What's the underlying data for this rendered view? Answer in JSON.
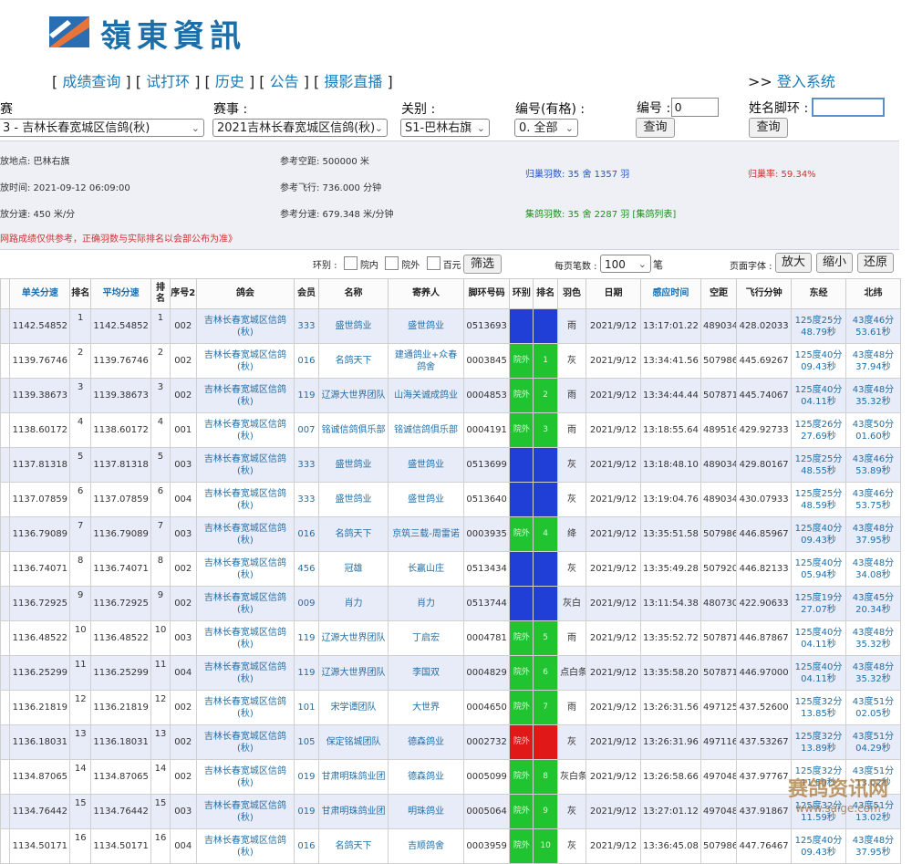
{
  "logo": {
    "text": "嶺東資訊",
    "icon": "logo-flag-icon"
  },
  "nav": {
    "items": [
      "成绩查询",
      "试打环",
      "历史",
      "公告",
      "摄影直播"
    ],
    "login_prefix": ">>",
    "login_label": "登入系统"
  },
  "filters": {
    "season_label": "赛",
    "season_value": "3 - 吉林长春宽城区信鸽(秋)",
    "race_label": "赛事 :",
    "race_value": "2021吉林长春宽城区信鸽(秋)",
    "stage_label": "关别 :",
    "stage_value": "S1-巴林右旗",
    "num_has_label": "编号(有格) :",
    "num_has_value": "0. 全部",
    "num_label": "编号 :",
    "num_value": "0",
    "query_label": "查询",
    "name_ring_label": "姓名脚环 :",
    "name_ring_value": "",
    "query2_label": "查询"
  },
  "info": {
    "release_place": "放地点:  巴林右旗",
    "release_time": "放时间:  2021-09-12 06:09:00",
    "speed": "放分速:  450 米/分",
    "ref_distance": "参考空距:  500000 米",
    "ref_flight": "参考飞行:  736.000 分钟",
    "ref_speed": "参考分速:  679.348 米/分钟",
    "returned": "归巢羽数:  35 舍 1357 羽",
    "collected": "集鸽羽数:  35 舍 2287 羽 [集鸽列表]",
    "return_rate": "归巢率:  59.34%",
    "note": "网路成绩仅供参考，正确羽数与实际排名以会部公布为准》",
    "colors": {
      "returned": "#2255cc",
      "collected": "#1a8f1a",
      "rate": "#d03030",
      "note": "#cc3333"
    }
  },
  "controls": {
    "ring_label": "环别 :",
    "opt_yard": "院内",
    "opt_out": "院外",
    "opt_hundred": "百元",
    "filter_btn": "筛选",
    "per_page_label": "每页笔数 :",
    "per_page_value": "100",
    "per_page_unit": "笔",
    "font_label": "页面字体 :",
    "zoom_in": "放大",
    "zoom_out": "缩小",
    "reset": "还原"
  },
  "table": {
    "headers": [
      "",
      "单关分速",
      "排名",
      "平均分速",
      "排名",
      "序号2",
      "鸽会",
      "会员",
      "名称",
      "寄养人",
      "脚环号码",
      "环别",
      "排名",
      "羽色",
      "日期",
      "感应时间",
      "空距",
      "飞行分钟",
      "东经",
      "北纬"
    ],
    "rows": [
      {
        "single": "1142.54852",
        "r1": "1",
        "avg": "1142.54852",
        "r2": "1",
        "seq": "002",
        "club": "吉林长春宽城区信鸽(秋)",
        "member": "333",
        "name": "盛世鸽业",
        "keeper": "盛世鸽业",
        "ring": "0513693",
        "ringtype": "",
        "rank": "",
        "ringcolor": "blue",
        "color": "雨",
        "date": "2021/9/12",
        "time": "13:17:01.22",
        "dist": "489034",
        "fly": "428.02033",
        "lon": "125度25分 48.79秒",
        "lat": "43度46分 53.61秒"
      },
      {
        "single": "1139.76746",
        "r1": "2",
        "avg": "1139.76746",
        "r2": "2",
        "seq": "002",
        "club": "吉林长春宽城区信鸽(秋)",
        "member": "016",
        "name": "名鸽天下",
        "keeper": "建通鸽业+众春鸽舍",
        "ring": "0003845",
        "ringtype": "院外",
        "rank": "1",
        "ringcolor": "green",
        "color": "灰",
        "date": "2021/9/12",
        "time": "13:34:41.56",
        "dist": "507986",
        "fly": "445.69267",
        "lon": "125度40分 09.43秒",
        "lat": "43度48分 37.94秒"
      },
      {
        "single": "1139.38673",
        "r1": "3",
        "avg": "1139.38673",
        "r2": "3",
        "seq": "002",
        "club": "吉林长春宽城区信鸽(秋)",
        "member": "119",
        "name": "辽源大世界团队",
        "keeper": "山海关诚成鸽业",
        "ring": "0004853",
        "ringtype": "院外",
        "rank": "2",
        "ringcolor": "green",
        "color": "雨",
        "date": "2021/9/12",
        "time": "13:34:44.44",
        "dist": "507871",
        "fly": "445.74067",
        "lon": "125度40分 04.11秒",
        "lat": "43度48分 35.32秒"
      },
      {
        "single": "1138.60172",
        "r1": "4",
        "avg": "1138.60172",
        "r2": "4",
        "seq": "001",
        "club": "吉林长春宽城区信鸽(秋)",
        "member": "007",
        "name": "铭诚信鸽俱乐部",
        "keeper": "铭诚信鸽俱乐部",
        "ring": "0004191",
        "ringtype": "院外",
        "rank": "3",
        "ringcolor": "green",
        "color": "雨",
        "date": "2021/9/12",
        "time": "13:18:55.64",
        "dist": "489516",
        "fly": "429.92733",
        "lon": "125度26分 27.69秒",
        "lat": "43度50分 01.60秒"
      },
      {
        "single": "1137.81318",
        "r1": "5",
        "avg": "1137.81318",
        "r2": "5",
        "seq": "003",
        "club": "吉林长春宽城区信鸽(秋)",
        "member": "333",
        "name": "盛世鸽业",
        "keeper": "盛世鸽业",
        "ring": "0513699",
        "ringtype": "",
        "rank": "",
        "ringcolor": "blue",
        "color": "灰",
        "date": "2021/9/12",
        "time": "13:18:48.10",
        "dist": "489034",
        "fly": "429.80167",
        "lon": "125度25分 48.55秒",
        "lat": "43度46分 53.89秒"
      },
      {
        "single": "1137.07859",
        "r1": "6",
        "avg": "1137.07859",
        "r2": "6",
        "seq": "004",
        "club": "吉林长春宽城区信鸽(秋)",
        "member": "333",
        "name": "盛世鸽业",
        "keeper": "盛世鸽业",
        "ring": "0513640",
        "ringtype": "",
        "rank": "",
        "ringcolor": "blue",
        "color": "灰",
        "date": "2021/9/12",
        "time": "13:19:04.76",
        "dist": "489034",
        "fly": "430.07933",
        "lon": "125度25分 48.59秒",
        "lat": "43度46分 53.75秒"
      },
      {
        "single": "1136.79089",
        "r1": "7",
        "avg": "1136.79089",
        "r2": "7",
        "seq": "003",
        "club": "吉林长春宽城区信鸽(秋)",
        "member": "016",
        "name": "名鸽天下",
        "keeper": "京筑三载-周雷诺",
        "ring": "0003935",
        "ringtype": "院外",
        "rank": "4",
        "ringcolor": "green",
        "color": "绛",
        "date": "2021/9/12",
        "time": "13:35:51.58",
        "dist": "507986",
        "fly": "446.85967",
        "lon": "125度40分 09.43秒",
        "lat": "43度48分 37.95秒"
      },
      {
        "single": "1136.74071",
        "r1": "8",
        "avg": "1136.74071",
        "r2": "8",
        "seq": "002",
        "club": "吉林长春宽城区信鸽(秋)",
        "member": "456",
        "name": "冠雄",
        "keeper": "长赢山庄",
        "ring": "0513434",
        "ringtype": "",
        "rank": "",
        "ringcolor": "blue",
        "color": "灰",
        "date": "2021/9/12",
        "time": "13:35:49.28",
        "dist": "507920",
        "fly": "446.82133",
        "lon": "125度40分 05.94秒",
        "lat": "43度48分 34.08秒"
      },
      {
        "single": "1136.72925",
        "r1": "9",
        "avg": "1136.72925",
        "r2": "9",
        "seq": "002",
        "club": "吉林长春宽城区信鸽(秋)",
        "member": "009",
        "name": "肖力",
        "keeper": "肖力",
        "ring": "0513744",
        "ringtype": "",
        "rank": "",
        "ringcolor": "blue",
        "color": "灰白",
        "date": "2021/9/12",
        "time": "13:11:54.38",
        "dist": "480730",
        "fly": "422.90633",
        "lon": "125度19分 27.07秒",
        "lat": "43度45分 20.34秒"
      },
      {
        "single": "1136.48522",
        "r1": "10",
        "avg": "1136.48522",
        "r2": "10",
        "seq": "003",
        "club": "吉林长春宽城区信鸽(秋)",
        "member": "119",
        "name": "辽源大世界团队",
        "keeper": "丁启宏",
        "ring": "0004781",
        "ringtype": "院外",
        "rank": "5",
        "ringcolor": "green",
        "color": "雨",
        "date": "2021/9/12",
        "time": "13:35:52.72",
        "dist": "507871",
        "fly": "446.87867",
        "lon": "125度40分 04.11秒",
        "lat": "43度48分 35.32秒"
      },
      {
        "single": "1136.25299",
        "r1": "11",
        "avg": "1136.25299",
        "r2": "11",
        "seq": "004",
        "club": "吉林长春宽城区信鸽(秋)",
        "member": "119",
        "name": "辽源大世界团队",
        "keeper": "李国双",
        "ring": "0004829",
        "ringtype": "院外",
        "rank": "6",
        "ringcolor": "green",
        "color": "点白条",
        "date": "2021/9/12",
        "time": "13:35:58.20",
        "dist": "507871",
        "fly": "446.97000",
        "lon": "125度40分 04.11秒",
        "lat": "43度48分 35.32秒"
      },
      {
        "single": "1136.21819",
        "r1": "12",
        "avg": "1136.21819",
        "r2": "12",
        "seq": "002",
        "club": "吉林长春宽城区信鸽(秋)",
        "member": "101",
        "name": "宋学谭团队",
        "keeper": "大世界",
        "ring": "0004650",
        "ringtype": "院外",
        "rank": "7",
        "ringcolor": "green",
        "color": "雨",
        "date": "2021/9/12",
        "time": "13:26:31.56",
        "dist": "497125",
        "fly": "437.52600",
        "lon": "125度32分 13.85秒",
        "lat": "43度51分 02.05秒"
      },
      {
        "single": "1136.18031",
        "r1": "13",
        "avg": "1136.18031",
        "r2": "13",
        "seq": "002",
        "club": "吉林长春宽城区信鸽(秋)",
        "member": "105",
        "name": "保定铭城团队",
        "keeper": "德森鸽业",
        "ring": "0002732",
        "ringtype": "院外",
        "rank": "",
        "ringcolor": "red",
        "color": "灰",
        "date": "2021/9/12",
        "time": "13:26:31.96",
        "dist": "497116",
        "fly": "437.53267",
        "lon": "125度32分 13.89秒",
        "lat": "43度51分 04.29秒"
      },
      {
        "single": "1134.87065",
        "r1": "14",
        "avg": "1134.87065",
        "r2": "14",
        "seq": "002",
        "club": "吉林长春宽城区信鸽(秋)",
        "member": "019",
        "name": "甘肃明珠鸽业团",
        "keeper": "德森鸽业",
        "ring": "0005099",
        "ringtype": "院外",
        "rank": "8",
        "ringcolor": "green",
        "color": "灰白条",
        "date": "2021/9/12",
        "time": "13:26:58.66",
        "dist": "497048",
        "fly": "437.97767",
        "lon": "125度32分 11.59秒",
        "lat": "43度51分 13.02秒"
      },
      {
        "single": "1134.76442",
        "r1": "15",
        "avg": "1134.76442",
        "r2": "15",
        "seq": "003",
        "club": "吉林长春宽城区信鸽(秋)",
        "member": "019",
        "name": "甘肃明珠鸽业团",
        "keeper": "明珠鸽业",
        "ring": "0005064",
        "ringtype": "院外",
        "rank": "9",
        "ringcolor": "green",
        "color": "灰",
        "date": "2021/9/12",
        "time": "13:27:01.12",
        "dist": "497048",
        "fly": "437.91867",
        "lon": "125度32分 11.59秒",
        "lat": "43度51分 13.02秒"
      },
      {
        "single": "1134.50171",
        "r1": "16",
        "avg": "1134.50171",
        "r2": "16",
        "seq": "004",
        "club": "吉林长春宽城区信鸽(秋)",
        "member": "016",
        "name": "名鸽天下",
        "keeper": "吉顺鸽舍",
        "ring": "0003959",
        "ringtype": "院外",
        "rank": "10",
        "ringcolor": "green",
        "color": "灰",
        "date": "2021/9/12",
        "time": "13:36:45.08",
        "dist": "507986",
        "fly": "447.76467",
        "lon": "125度40分 09.43秒",
        "lat": "43度48分 37.95秒"
      }
    ]
  },
  "watermark": {
    "text": "赛鸽资讯网",
    "url": "www.saige.com"
  }
}
